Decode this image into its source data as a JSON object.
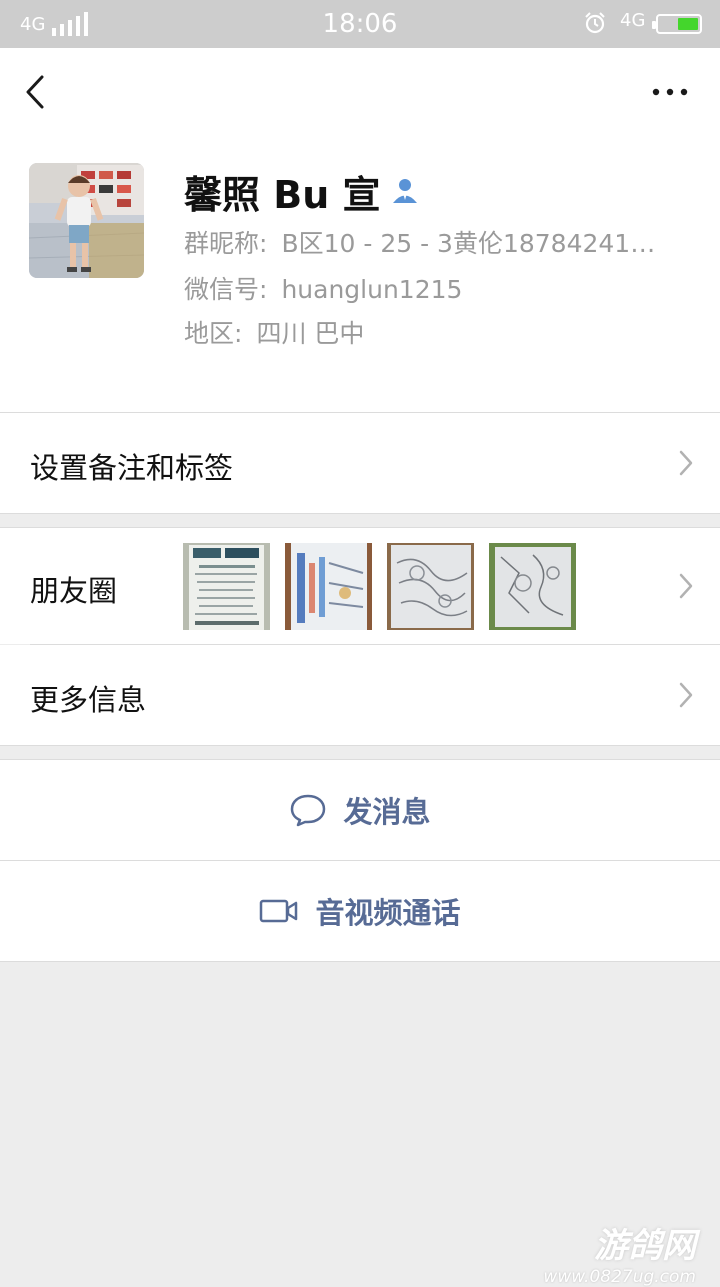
{
  "status_bar": {
    "network_left": "4G",
    "time": "18:06",
    "network_right": "4G"
  },
  "profile": {
    "name": "馨照 Bu 宣",
    "nickname_label": "群昵称:",
    "nickname_value": "B区10 - 25 - 3黄伦18784241…",
    "wechat_id_label": "微信号:",
    "wechat_id_value": "huanglun1215",
    "region_label": "地区:",
    "region_value": "四川  巴中"
  },
  "rows": {
    "remark_label": "设置备注和标签",
    "moments_label": "朋友圈",
    "more_info_label": "更多信息"
  },
  "actions": {
    "send_message_label": "发消息",
    "video_call_label": "音视频通话"
  },
  "watermark": {
    "brand": "游鸽网",
    "url": "www.0827ug.com"
  },
  "colors": {
    "accent": "#576b95",
    "background": "#ededed",
    "status_bar": "#cdcdcd"
  },
  "icons": {
    "back": "chevron-left-icon",
    "more": "ellipsis-icon",
    "person": "person-icon",
    "chat": "chat-bubble-icon",
    "video": "video-camera-icon"
  }
}
